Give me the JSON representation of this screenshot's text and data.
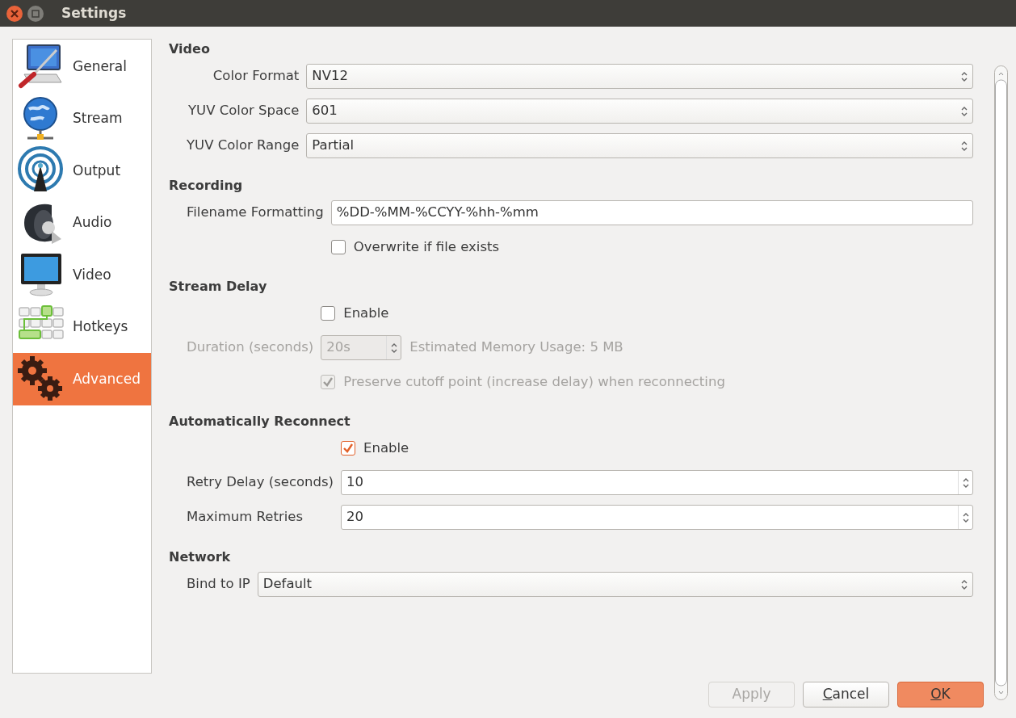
{
  "window": {
    "title": "Settings"
  },
  "sidebar": {
    "items": [
      {
        "kind": "general",
        "label": "General",
        "selected": false
      },
      {
        "kind": "stream",
        "label": "Stream",
        "selected": false
      },
      {
        "kind": "output",
        "label": "Output",
        "selected": false
      },
      {
        "kind": "audio",
        "label": "Audio",
        "selected": false
      },
      {
        "kind": "video",
        "label": "Video",
        "selected": false
      },
      {
        "kind": "hotkeys",
        "label": "Hotkeys",
        "selected": false
      },
      {
        "kind": "advanced",
        "label": "Advanced",
        "selected": true
      }
    ]
  },
  "sections": [
    {
      "title": "Video",
      "rows": [
        {
          "kind": "select",
          "label": "Color Format",
          "value": "NV12"
        },
        {
          "kind": "select",
          "label": "YUV Color Space",
          "value": "601"
        },
        {
          "kind": "select",
          "label": "YUV Color Range",
          "value": "Partial"
        }
      ]
    },
    {
      "title": "Recording",
      "rows": [
        {
          "kind": "text",
          "label": "Filename Formatting",
          "value": "%DD-%MM-%CCYY-%hh-%mm"
        },
        {
          "kind": "checkbox",
          "label": "Overwrite if file exists",
          "checked": false
        }
      ]
    },
    {
      "title": "Stream Delay",
      "rows": [
        {
          "kind": "checkbox",
          "label": "Enable",
          "checked": false
        },
        {
          "kind": "spin_note",
          "label": "Duration (seconds)",
          "value": "20s",
          "note": "Estimated Memory Usage: 5 MB",
          "disabled": true
        },
        {
          "kind": "checkbox",
          "label": "Preserve cutoff point (increase delay) when reconnecting",
          "checked": true,
          "disabled": true
        }
      ]
    },
    {
      "title": "Automatically Reconnect",
      "rows": [
        {
          "kind": "checkbox",
          "label": "Enable",
          "checked": true
        },
        {
          "kind": "spin",
          "label": "Retry Delay (seconds)",
          "value": "10"
        },
        {
          "kind": "spin",
          "label": "Maximum Retries",
          "value": "20"
        }
      ]
    },
    {
      "title": "Network",
      "rows": [
        {
          "kind": "select",
          "label": "Bind to IP",
          "value": "Default"
        }
      ]
    }
  ],
  "buttons": [
    {
      "label": "Apply",
      "disabled": true,
      "primary": false,
      "underline_first": false
    },
    {
      "label": "Cancel",
      "disabled": false,
      "primary": false,
      "underline_first": true
    },
    {
      "label": "OK",
      "disabled": false,
      "primary": true,
      "underline_first": true
    }
  ]
}
